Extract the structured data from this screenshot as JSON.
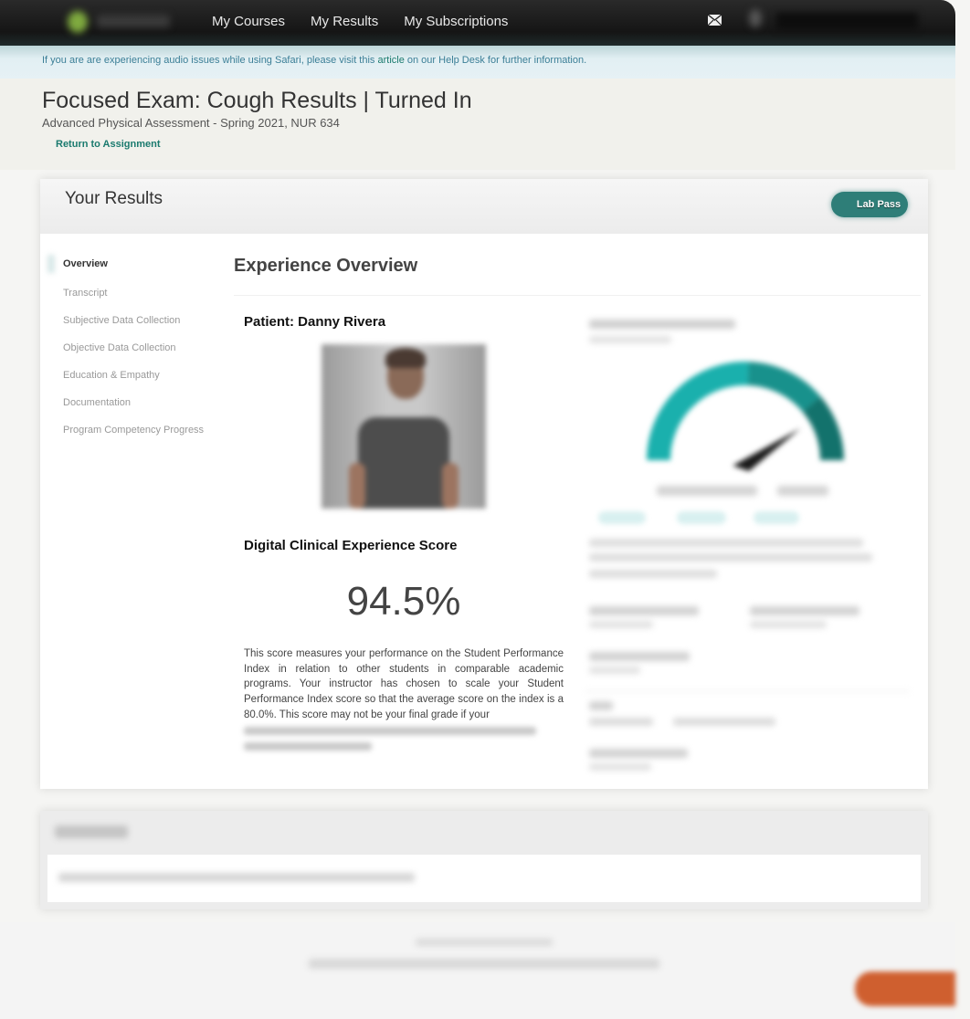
{
  "nav": {
    "logo_icon": "brand-logo",
    "links": [
      {
        "label": "My Courses"
      },
      {
        "label": "My Results"
      },
      {
        "label": "My Subscriptions"
      }
    ],
    "mail_icon": "envelope-icon"
  },
  "notice": {
    "text_before": "If you are are experiencing audio issues while using Safari, please visit this ",
    "link_text": "article",
    "text_after": " on our Help Desk for further information."
  },
  "page": {
    "title": "Focused Exam: Cough Results | Turned In",
    "subtitle": "Advanced Physical Assessment - Spring 2021, NUR 634",
    "return_link": "Return to Assignment"
  },
  "results": {
    "title": "Your Results",
    "lab_pass_button": "Lab Pass",
    "sidebar": [
      {
        "label": "Overview",
        "active": true
      },
      {
        "label": "Transcript",
        "active": false
      },
      {
        "label": "Subjective Data Collection",
        "active": false
      },
      {
        "label": "Objective Data Collection",
        "active": false
      },
      {
        "label": "Education & Empathy",
        "active": false
      },
      {
        "label": "Documentation",
        "active": false
      },
      {
        "label": "Program Competency Progress",
        "active": false
      }
    ],
    "overview": {
      "title": "Experience Overview",
      "patient_label": "Patient: Danny Rivera",
      "score_title": "Digital Clinical Experience Score",
      "score_value": "94.5%",
      "score_description": "This score measures your performance on the Student Performance Index in relation to other students in comparable academic programs. Your instructor has chosen to scale your Student Performance Index score so that the average score on the index is a 80.0%. This score may not be your final grade if your"
    },
    "gauge": {
      "colors": {
        "low": "#1ab0ad",
        "mid": "#18918c",
        "high": "#13726c",
        "needle": "#1a1a1a"
      }
    }
  },
  "colors": {
    "accent": "#1a7a6e",
    "lab_pass": "#2e7e78",
    "help_button": "#cf5f2f",
    "nav_bg": "#1a1a1a"
  }
}
